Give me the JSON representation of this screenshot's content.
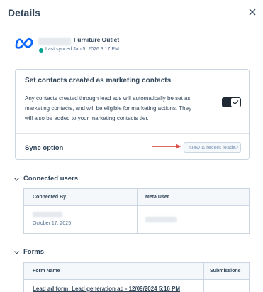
{
  "panel": {
    "title": "Details",
    "close_icon": "close-icon"
  },
  "account": {
    "name": "Furniture Outlet",
    "sync_status": "Last synced Jan 5, 2026 3:17 PM",
    "status_color": "#00a38d",
    "logo_icon": "meta-logo-icon"
  },
  "marketing_contacts": {
    "title": "Set contacts created as marketing contacts",
    "description": "Any contacts created through lead ads will automatically be set as marketing contacts, and will be eligible for marketing actions. They will also be added to your marketing contacts tier.",
    "toggle_on": true
  },
  "sync_option": {
    "label": "Sync option",
    "selected": "New & recent leads",
    "arrow_color": "#d9534f"
  },
  "connected_users": {
    "title": "Connected users",
    "columns": [
      "Connected By",
      "Meta User"
    ],
    "rows": [
      {
        "date": "October 17, 2025"
      }
    ]
  },
  "forms": {
    "title": "Forms",
    "columns": [
      "Form Name",
      "Submissions"
    ],
    "rows": [
      {
        "name": "Lead ad form: Lead generation ad - 12/09/2024 5:16 PM"
      }
    ]
  }
}
